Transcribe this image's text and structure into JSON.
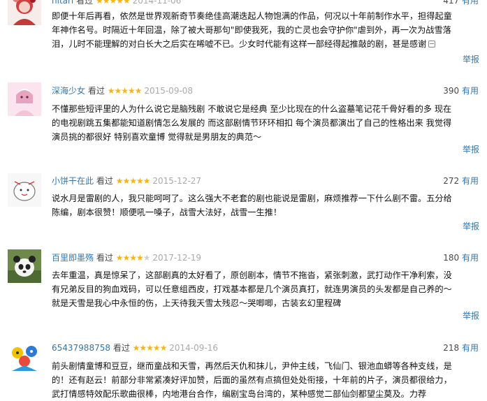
{
  "reviews": [
    {
      "user": "hitari",
      "action": "看过",
      "rating": 5,
      "date": "2014-11-06",
      "useful_count": "417",
      "useful_label": "有用",
      "lines": [
        "即便十年后再看，依然是世界观新奇节奏绝佳高潮迭起人物饱满的作品，何况以十年前制作水平，担得起童",
        "年神作名号。时隔近十年回温，除了被大哥那句\"即使我死，我的亡灵也会守护你\"虐到外，再一次为战雪落",
        "泪，儿时不能理解的对白长大之后实在唏嘘不已。少女时代能有这样一部经得起推敲的剧，甚是感谢"
      ],
      "report": "举报"
    },
    {
      "user": "深海少女",
      "action": "看过",
      "rating": 5,
      "date": "2015-09-08",
      "useful_count": "390",
      "useful_label": "有用",
      "lines": [
        "不懂那些短评里的人为什么说它是脑残剧 不敢说它是经典 至少比现在的什么盗墓笔记花千骨好看的多 现在",
        "的电视剧跳五集都能知道剧情怎么发展的 而这部剧情节环环相扣 每个演员都演出了自己的性格出来 我觉得",
        "演员挑的都很好 特别喜欢童博 觉得就是男朋友的典范～"
      ],
      "report": "举报"
    },
    {
      "user": "小饼干在此",
      "action": "看过",
      "rating": 5,
      "date": "2015-12-27",
      "useful_count": "272",
      "useful_label": "有用",
      "lines": [
        "说水月是雷剧的人，我只能呵呵了。这么强大不老套的剧也能说是雷剧，麻烦推荐一下什么剧不雷。五分给",
        "陈编，剧本很赞！顺便吼一嗓子，战雪大法好，战雪一生推！"
      ],
      "report": "举报"
    },
    {
      "user": "百里即墨殇",
      "action": "看过",
      "rating": 4,
      "date": "2017-12-19",
      "useful_count": "180",
      "useful_label": "有用",
      "lines": [
        "去年重温，真是惊呆了，这部剧真的太好看了，原创剧本，情节不拖沓，紧张刺激，武打动作干净利索，没",
        "有兄弟反目的狗血戏码，可以任意组西皮，打戏基本都是几个演员真打，就连男演员的头发都是自己养的～",
        "就是天雪是我心中永恒的伤，上天待我天雪太残忍～哭唧唧，古装玄幻里程碑"
      ],
      "report": "举报"
    },
    {
      "user": "65437988758",
      "action": "看过",
      "rating": 5,
      "date": "2014-09-16",
      "useful_count": "218",
      "useful_label": "有用",
      "lines": [
        "前头剧情童博和豆豆，继而童战和天雪，再然后天仇和抹儿，尹仲主线，飞仙门、银池血蟒等各种支线，是",
        "的！还有赵云！前部分非常紧凑好评加赞，后面的虽然有点搞但处处衔接，十年前的片子，演员都很给力，",
        "武打情感特效配乐歌曲很棒，内地港台合作，编剧宝岛台湾的，某种感觉二部仙剑都望尘莫及。力荐"
      ],
      "report": ""
    }
  ],
  "star_full": "★",
  "icons": {
    "expand": "expand-icon"
  }
}
